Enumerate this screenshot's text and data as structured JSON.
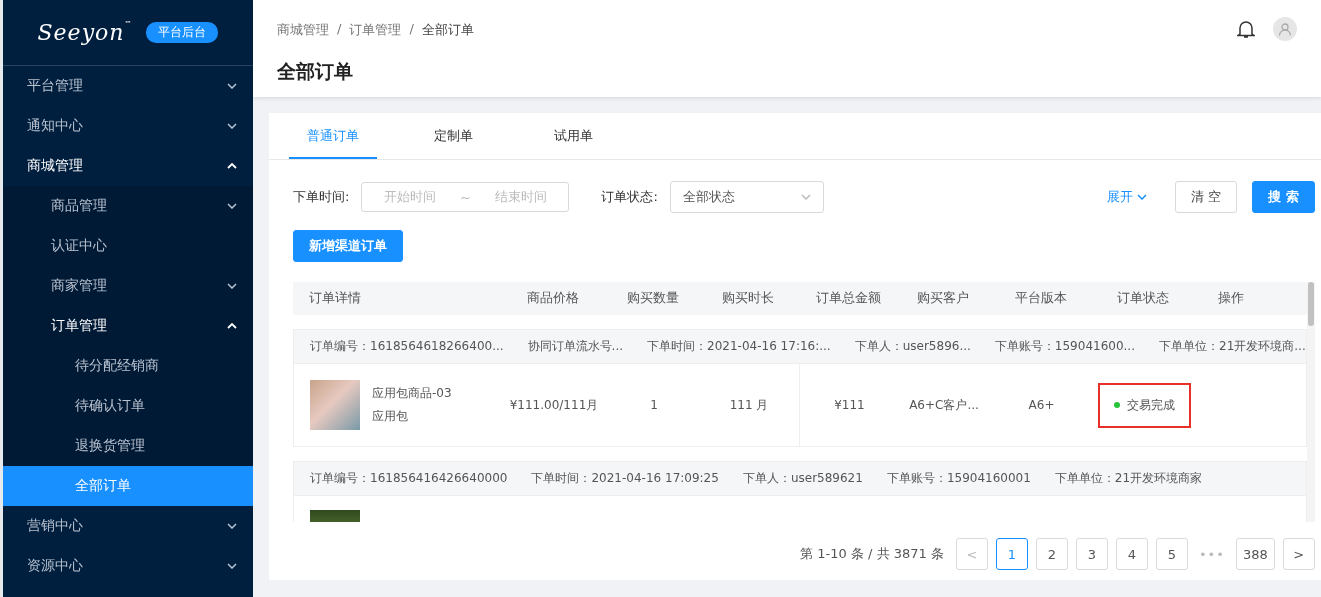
{
  "sidebar": {
    "logo": "Seeyon",
    "logo_mark": "™",
    "badge": "平台后台",
    "items": [
      {
        "label": "平台管理",
        "expanded": false
      },
      {
        "label": "通知中心",
        "expanded": false
      },
      {
        "label": "商城管理",
        "expanded": true,
        "children": [
          {
            "label": "商品管理",
            "expanded": false
          },
          {
            "label": "认证中心",
            "selected": false
          },
          {
            "label": "商家管理",
            "expanded": false
          },
          {
            "label": "订单管理",
            "expanded": true,
            "children": [
              {
                "label": "待分配经销商",
                "selected": false
              },
              {
                "label": "待确认订单",
                "selected": false
              },
              {
                "label": "退换货管理",
                "selected": false
              },
              {
                "label": "全部订单",
                "selected": true
              }
            ]
          }
        ]
      },
      {
        "label": "营销中心",
        "expanded": false
      },
      {
        "label": "资源中心",
        "expanded": false
      }
    ]
  },
  "header": {
    "breadcrumb": [
      "商城管理",
      "订单管理",
      "全部订单"
    ],
    "breadcrumb_separator": "/",
    "title": "全部订单"
  },
  "tabs": [
    {
      "label": "普通订单",
      "selected": true
    },
    {
      "label": "定制单",
      "selected": false
    },
    {
      "label": "试用单",
      "selected": false
    }
  ],
  "filters": {
    "time_label": "下单时间:",
    "start_placeholder": "开始时间",
    "range_separator": "~",
    "end_placeholder": "结束时间",
    "status_label": "订单状态:",
    "status_value": "全部状态",
    "expand_link": "展开",
    "clear_button": "清 空",
    "search_button": "搜 索",
    "new_button": "新增渠道订单"
  },
  "table": {
    "columns": [
      "订单详情",
      "商品价格",
      "购买数量",
      "购买时长",
      "订单总金额",
      "购买客户",
      "平台版本",
      "订单状态",
      "操作"
    ],
    "orders": [
      {
        "info": [
          "订单编号：1618564618266400...",
          "协同订单流水号...",
          "下单时间：2021-04-16 17:16:...",
          "下单人：user5896...",
          "下单账号：159041600...",
          "下单单位：21开发环境商..."
        ],
        "items": [
          {
            "name": "应用包商品-03",
            "type": "应用包",
            "price": "¥111.00/111月",
            "quantity": "1",
            "duration": "111 月",
            "total": "¥111",
            "customer": "A6+C客户...",
            "version": "A6+",
            "status": "交易完成",
            "color": "#27c33a",
            "highlighted": true
          }
        ]
      },
      {
        "info": [
          "订单编号：161856416426640000",
          "下单时间：2021-04-16 17:09:25",
          "下单人：user589621",
          "下单账号：15904160001",
          "下单单位：21开发环境商家"
        ]
      }
    ]
  },
  "pagination": {
    "summary": "第 1-10 条 / 共 3871 条",
    "prev": "<",
    "next": ">",
    "ellipsis": "•••",
    "pages": [
      {
        "label": "1",
        "selected": true
      },
      {
        "label": "2",
        "selected": false
      },
      {
        "label": "3",
        "selected": false
      },
      {
        "label": "4",
        "selected": false
      },
      {
        "label": "5",
        "selected": false
      },
      {
        "label": "388",
        "selected": false,
        "kind": "last"
      }
    ]
  }
}
